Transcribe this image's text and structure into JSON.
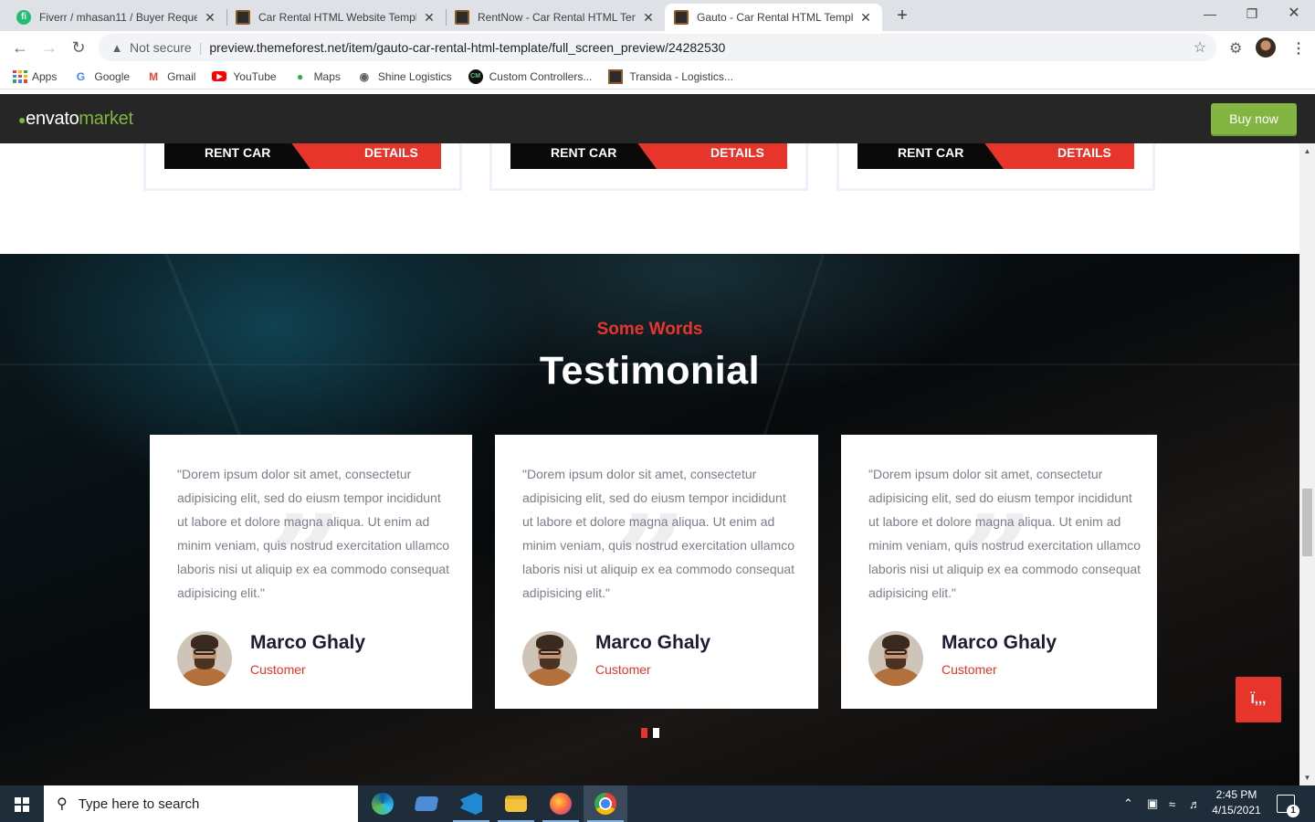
{
  "browser": {
    "tabs": [
      {
        "title": "Fiverr / mhasan11 / Buyer Reque",
        "icon": "fiverr-icon"
      },
      {
        "title": "Car Rental HTML Website Templa",
        "icon": "themeforest-icon"
      },
      {
        "title": "RentNow - Car Rental HTML Tem",
        "icon": "themeforest-icon"
      },
      {
        "title": "Gauto - Car Rental HTML Templa",
        "icon": "themeforest-icon",
        "active": true
      }
    ],
    "security_label": "Not secure",
    "url": "preview.themeforest.net/item/gauto-car-rental-html-template/full_screen_preview/24282530",
    "bookmarks": [
      {
        "label": "Apps",
        "icon": "apps-grid-icon"
      },
      {
        "label": "Google",
        "icon": "google-icon"
      },
      {
        "label": "Gmail",
        "icon": "gmail-icon"
      },
      {
        "label": "YouTube",
        "icon": "youtube-icon"
      },
      {
        "label": "Maps",
        "icon": "maps-icon"
      },
      {
        "label": "Shine Logistics",
        "icon": "globe-icon"
      },
      {
        "label": "Custom Controllers...",
        "icon": "cm-icon"
      },
      {
        "label": "Transida - Logistics...",
        "icon": "themeforest-icon"
      }
    ]
  },
  "envato": {
    "logo_envato": "envato",
    "logo_market": "market",
    "buy_now": "Buy now"
  },
  "cars": [
    {
      "rent_label": "RENT CAR",
      "details_label": "DETAILS"
    },
    {
      "rent_label": "RENT CAR",
      "details_label": "DETAILS"
    },
    {
      "rent_label": "RENT CAR",
      "details_label": "DETAILS"
    }
  ],
  "testimonial": {
    "eyebrow": "Some Words",
    "heading": "Testimonial",
    "cards": [
      {
        "quote": "\"Dorem ipsum dolor sit amet, consectetur adipisicing elit, sed do eiusm tempor incididunt ut labore et dolore magna aliqua. Ut enim ad minim veniam, quis nostrud exercitation ullamco laboris nisi ut aliquip ex ea commodo consequat adipisicing elit.\"",
        "name": "Marco Ghaly",
        "role": "Customer"
      },
      {
        "quote": "\"Dorem ipsum dolor sit amet, consectetur adipisicing elit, sed do eiusm tempor incididunt ut labore et dolore magna aliqua. Ut enim ad minim veniam, quis nostrud exercitation ullamco laboris nisi ut aliquip ex ea commodo consequat adipisicing elit.\"",
        "name": "Marco Ghaly",
        "role": "Customer"
      },
      {
        "quote": "\"Dorem ipsum dolor sit amet, consectetur adipisicing elit, sed do eiusm tempor incididunt ut labore et dolore magna aliqua. Ut enim ad minim veniam, quis nostrud exercitation ullamco laboris nisi ut aliquip ex ea commodo consequat adipisicing elit.\"",
        "name": "Marco Ghaly",
        "role": "Customer"
      }
    ],
    "active_slide": 1,
    "slide_count": 2,
    "chat_button_label": "Ï,,,"
  },
  "taskbar": {
    "search_placeholder": "Type here to search",
    "apps": [
      "edge-icon",
      "task-view-icon",
      "vscode-icon",
      "file-explorer-icon",
      "firefox-icon",
      "chrome-icon"
    ],
    "time": "2:45 PM",
    "date": "4/15/2021",
    "notification_count": "1"
  },
  "colors": {
    "accent_red": "#e8352b",
    "envato_green": "#82b541",
    "envato_bar": "#262626",
    "heading_dark": "#1b1d33"
  }
}
